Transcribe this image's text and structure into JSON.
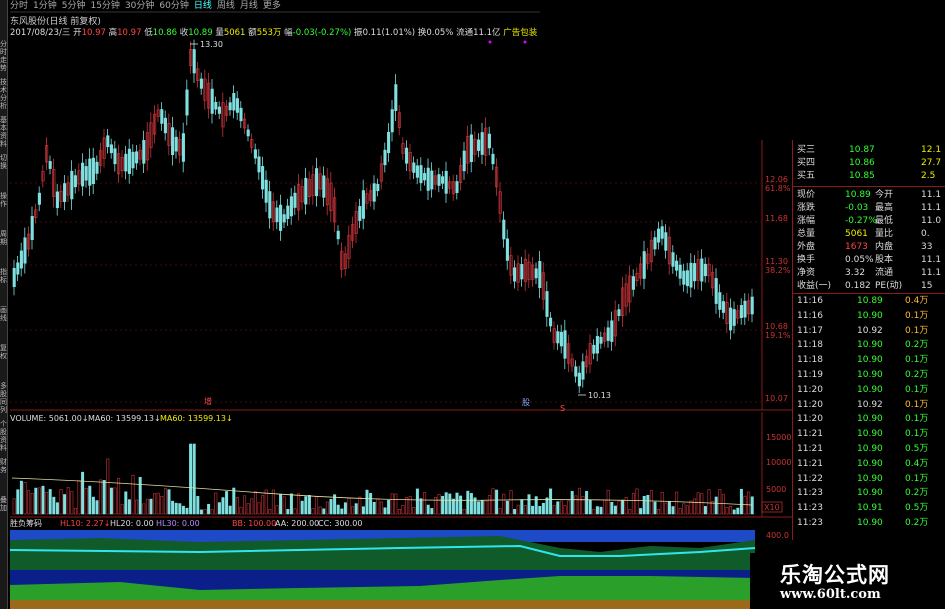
{
  "tabs": [
    "分时",
    "1分钟",
    "5分钟",
    "15分钟",
    "30分钟",
    "60分钟",
    "日线",
    "周线",
    "月线",
    "更多"
  ],
  "info1": "东风股份(日线 前复权)",
  "info2": {
    "date": "2017/08/23/三",
    "open_l": "开",
    "open": "10.97",
    "high_l": "高",
    "high": "10.97",
    "low_l": "低",
    "low": "10.86",
    "close_l": "收",
    "close": "10.89",
    "vol_l": "量",
    "vol": "5061",
    "amt_l": "额",
    "amt": "553万",
    "chg_l": "幅",
    "chg": "-0.03(-0.27%)",
    "amp_l": "振",
    "amp": "0.11(1.01%)",
    "tr_l": "换",
    "tr": "0.05%",
    "cap_l": "流通",
    "cap": "11.1亿",
    "tag": "广告包装"
  },
  "sidebar": [
    "分时走势",
    "技术分析",
    "基本资料",
    "切换",
    "操作",
    "周期",
    "指标",
    "画线",
    "复权",
    "多股同列",
    "个股资料",
    "财务",
    "叠加"
  ],
  "chart_data": {
    "type": "candlestick",
    "title": "东风股份(日线 前复权)",
    "y_ticks": [
      {
        "v": "12.06",
        "pct": "61.8%"
      },
      {
        "v": "11.68",
        "pct": ""
      },
      {
        "v": "11.30",
        "pct": "38.2%"
      },
      {
        "v": "10.68",
        "pct": "19.1%"
      },
      {
        "v": "10.07",
        "pct": ""
      }
    ],
    "high_label": "13.30",
    "low_label": "10.13",
    "markers": [
      {
        "t": "增",
        "c": "#f44"
      },
      {
        "t": "股",
        "c": "#8af"
      },
      {
        "t": "S",
        "c": "#f44"
      }
    ],
    "volume_legend": {
      "vol": "VOLUME: 5061.00↓",
      "ma1": "MA60: 13599.13↓",
      "ma2": "MA60: 13599.13↓"
    },
    "vol_ticks": [
      "15000",
      "10000",
      "5000",
      "X10"
    ],
    "ind_legend": {
      "name": "胜负筹码",
      "a": "HL10: 2.27↓",
      "b": "HL20: 0.00",
      "c": "HL30: 0.00",
      "d": "BB: 100.00",
      "e": "AA: 200.00",
      "f": "CC: 300.00"
    },
    "ind_ticks": [
      "400.0"
    ]
  },
  "quote": {
    "bids": [
      {
        "l": "买三",
        "p": "10.87",
        "v": "12.1"
      },
      {
        "l": "买四",
        "p": "10.86",
        "v": "27.7"
      },
      {
        "l": "买五",
        "p": "10.85",
        "v": "2.5"
      }
    ],
    "stats": [
      {
        "l": "现价",
        "v": "10.89",
        "l2": "今开",
        "v2": "11.1",
        "c": "g"
      },
      {
        "l": "涨跌",
        "v": "-0.03",
        "l2": "最高",
        "v2": "11.1",
        "c": "g"
      },
      {
        "l": "涨幅",
        "v": "-0.27%",
        "l2": "最低",
        "v2": "11.0",
        "c": "g"
      },
      {
        "l": "总量",
        "v": "5061",
        "l2": "量比",
        "v2": "0.",
        "c": "y"
      },
      {
        "l": "外盘",
        "v": "1673",
        "l2": "内盘",
        "v2": "33",
        "c": "r"
      },
      {
        "l": "换手",
        "v": "0.05%",
        "l2": "股本",
        "v2": "11.1",
        "c": "w"
      },
      {
        "l": "净资",
        "v": "3.32",
        "l2": "流通",
        "v2": "11.1",
        "c": "w"
      },
      {
        "l": "收益(一)",
        "v": "0.182",
        "l2": "PE(动)",
        "v2": "15",
        "c": "w"
      }
    ],
    "ticks": [
      {
        "t": "11:16",
        "p": "10.89",
        "v": "0.4万",
        "pc": "g",
        "vc": "o"
      },
      {
        "t": "11:16",
        "p": "10.90",
        "v": "0.1万",
        "pc": "g",
        "vc": "o"
      },
      {
        "t": "11:17",
        "p": "10.92",
        "v": "0.1万",
        "pc": "w",
        "vc": "o"
      },
      {
        "t": "11:18",
        "p": "10.90",
        "v": "0.2万",
        "pc": "g",
        "vc": "g"
      },
      {
        "t": "11:18",
        "p": "10.90",
        "v": "0.1万",
        "pc": "g",
        "vc": "g"
      },
      {
        "t": "11:19",
        "p": "10.90",
        "v": "0.2万",
        "pc": "g",
        "vc": "g"
      },
      {
        "t": "11:20",
        "p": "10.90",
        "v": "0.1万",
        "pc": "g",
        "vc": "g"
      },
      {
        "t": "11:20",
        "p": "10.92",
        "v": "0.1万",
        "pc": "w",
        "vc": "o"
      },
      {
        "t": "11:20",
        "p": "10.90",
        "v": "0.1万",
        "pc": "g",
        "vc": "g"
      },
      {
        "t": "11:21",
        "p": "10.90",
        "v": "0.1万",
        "pc": "g",
        "vc": "g"
      },
      {
        "t": "11:21",
        "p": "10.90",
        "v": "0.5万",
        "pc": "g",
        "vc": "g"
      },
      {
        "t": "11:21",
        "p": "10.90",
        "v": "0.4万",
        "pc": "g",
        "vc": "g"
      },
      {
        "t": "11:22",
        "p": "10.90",
        "v": "0.1万",
        "pc": "g",
        "vc": "g"
      },
      {
        "t": "11:23",
        "p": "10.90",
        "v": "0.2万",
        "pc": "g",
        "vc": "g"
      },
      {
        "t": "11:23",
        "p": "10.91",
        "v": "0.5万",
        "pc": "g",
        "vc": "g"
      },
      {
        "t": "11:23",
        "p": "10.90",
        "v": "0.2万",
        "pc": "g",
        "vc": "g"
      }
    ]
  },
  "watermark": {
    "cn": "乐淘公式网",
    "url": "www.60lt.com"
  }
}
